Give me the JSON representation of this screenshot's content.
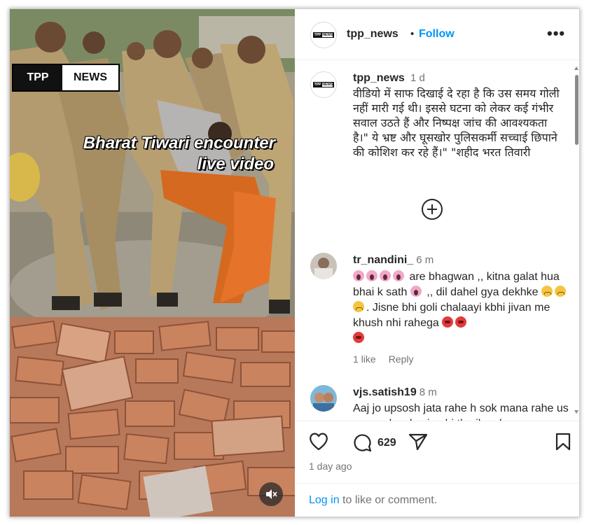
{
  "media": {
    "logo_left": "TPP",
    "logo_right": "NEWS",
    "caption_line1": "Bharat Tiwari encounter",
    "caption_line2": "live video",
    "mute_icon": "muted-speaker-icon"
  },
  "header": {
    "username": "tpp_news",
    "separator": "•",
    "follow_label": "Follow",
    "more_icon": "more-options-icon"
  },
  "caption": {
    "username": "tpp_news",
    "time": "1 d",
    "text": "वीडियो में साफ दिखाई दे रहा है कि उस समय गोली नहीं मारी गई थी। इससे घटना को लेकर कई गंभीर सवाल उठते हैं और निष्पक्ष जांच की आवश्यकता है।\" ये भ्रष्ट और घूसखोर पुलिसकर्मी सच्चाई छिपाने की कोशिश कर रहे हैं।\" \"शहीद भरत तिवारी"
  },
  "comments": [
    {
      "username": "tr_nandini_",
      "time": "6 m",
      "text_a": "are bhagwan ,, kitna galat hua bhai k sath",
      "text_b": ",, dil dahel gya dekhke",
      "text_c": ". Jisne bhi goli chalaayi kbhi jivan me khush nhi rahega",
      "likes": "1 like",
      "reply": "Reply"
    },
    {
      "username": "vjs.satish19",
      "time": "8 m",
      "text": "Aaj jo upsosh jata rahe h sok mana rahe us samay kya koyi nahi tha jb yelog"
    }
  ],
  "actions": {
    "comment_count": "629",
    "date": "1 day ago",
    "login_link": "Log in",
    "login_rest": " to like or comment."
  }
}
